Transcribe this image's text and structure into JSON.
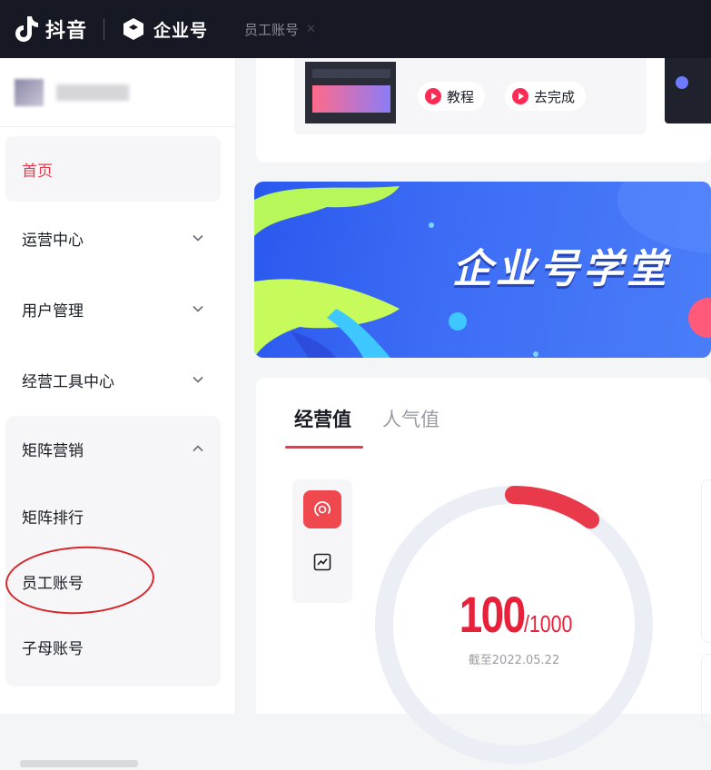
{
  "topbar": {
    "brand": "抖音",
    "product": "企业号",
    "open_tab": "员工账号",
    "close_symbol": "✕"
  },
  "sidebar": {
    "home": "首页",
    "items": [
      {
        "label": "运营中心"
      },
      {
        "label": "用户管理"
      },
      {
        "label": "经营工具中心"
      }
    ],
    "group": {
      "label": "矩阵营销",
      "children": [
        "矩阵排行",
        "员工账号",
        "子母账号"
      ]
    }
  },
  "task": {
    "tutorial": "教程",
    "complete": "去完成"
  },
  "banner": {
    "title": "企业号学堂"
  },
  "stats": {
    "tabs": [
      "经营值",
      "人气值"
    ],
    "value": "100",
    "max": "/1000",
    "progress_fraction": 0.1,
    "date": "截至2022.05.22"
  },
  "colors": {
    "accent": "#e83a4a",
    "topbar": "#161823",
    "banner": "#3c6cf5"
  }
}
